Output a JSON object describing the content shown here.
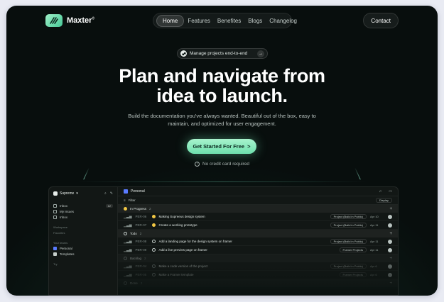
{
  "brand": {
    "name": "Maxter",
    "mark": "®"
  },
  "nav": {
    "items": [
      {
        "label": "Home",
        "active": true
      },
      {
        "label": "Features"
      },
      {
        "label": "Benefites"
      },
      {
        "label": "Blogs"
      },
      {
        "label": "Changelog"
      }
    ],
    "contact_label": "Contact"
  },
  "hero": {
    "pill_label": "Manage projects end-to-end",
    "headline_line1": "Plan and navigate from",
    "headline_line2": "idea to launch.",
    "subtitle_line1": "Build the documentation you've always wanted. Beautiful out of the box, easy to",
    "subtitle_line2": "maintain, and optimized for user engagement.",
    "cta_label": "Get Started For Free",
    "cta_arrow": ">",
    "no_card_label": "No credit card required"
  },
  "colors": {
    "accent": "#6ee0ad",
    "background": "#0a1512",
    "frame": "#e9ebf3"
  },
  "app": {
    "workspace": "Supreme",
    "sidebar": {
      "items": [
        {
          "label": "Inbox",
          "badge": "12"
        },
        {
          "label": "My issues"
        },
        {
          "label": "Inbox"
        }
      ],
      "workspace_label": "Workspace",
      "favorites_label": "Favorites",
      "teams_label": "Your teams",
      "teams": [
        {
          "label": "Personal",
          "color": "#5a7bff"
        },
        {
          "label": "Templates",
          "color": "#c6cfcc"
        }
      ],
      "try_label": "Try"
    },
    "header": {
      "title": "Personal",
      "filter_label": "Filter",
      "display_label": "Display"
    },
    "groups": [
      {
        "label": "In Progress",
        "count": "2",
        "status_color": "#f2c744",
        "rows": [
          {
            "id": "PER-06",
            "title": "Making Supreeus design system",
            "project": "Project (Build in Public)",
            "date": "Apr 10"
          },
          {
            "id": "PER-07",
            "title": "Create a working prototype",
            "project": "Project (Build in Public)",
            "date": "Apr 11"
          }
        ]
      },
      {
        "label": "Todo",
        "count": "2",
        "status_color": "#c6cfcc",
        "rows": [
          {
            "id": "PER-08",
            "title": "Add a landing page for the design system on framer",
            "project": "Project (Build in Public)",
            "date": "Apr 11"
          },
          {
            "id": "PER-09",
            "title": "Add a live preview page on framer",
            "project": "Framer Projects",
            "date": "Apr 11"
          }
        ]
      },
      {
        "label": "Backlog",
        "count": "2",
        "status_color": "#7f8a87",
        "rows": [
          {
            "id": "PER-04",
            "title": "Make a code version of the project",
            "project": "Project (Build in Public)",
            "date": "Apr 6"
          },
          {
            "id": "PER-05",
            "title": "Make a Framer template",
            "project": "Framer Projects",
            "date": "Apr 6"
          }
        ]
      },
      {
        "label": "Done",
        "count": "3",
        "status_color": "#7f8a87",
        "rows": []
      }
    ]
  }
}
